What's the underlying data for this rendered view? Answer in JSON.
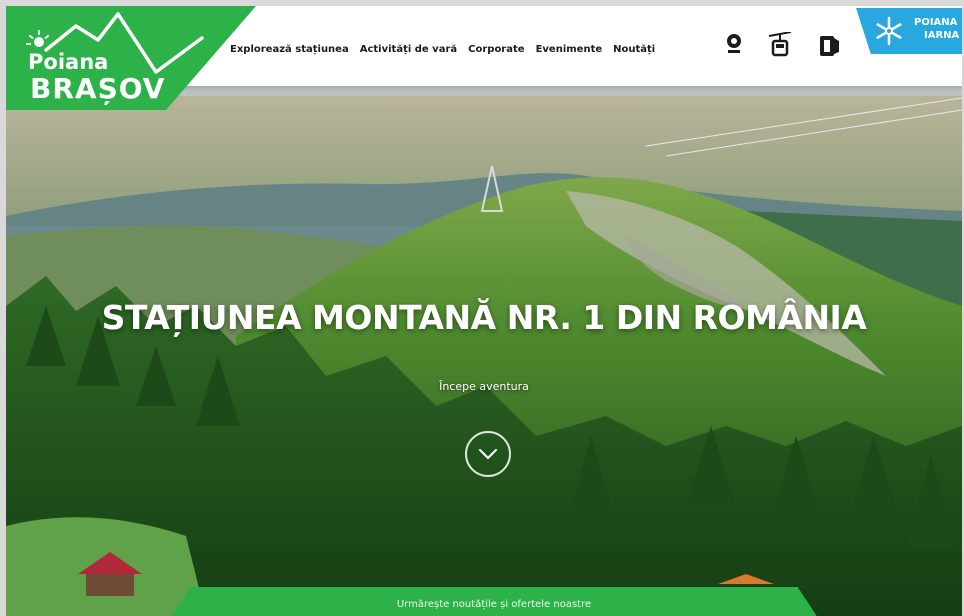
{
  "brand": {
    "logo_line_1": "Poiana",
    "logo_line_2": "BRAȘOV",
    "green": "#2db24a"
  },
  "nav": {
    "items": [
      {
        "label": "Explorează stațiunea"
      },
      {
        "label": "Activități de vară"
      },
      {
        "label": "Corporate"
      },
      {
        "label": "Evenimente"
      },
      {
        "label": "Noutăți"
      }
    ]
  },
  "utility_icons": [
    "webcam-icon",
    "cable-car-icon",
    "ski-pass-icon"
  ],
  "winter_tab": {
    "line_1": "POIANA",
    "line_2": "IARNA",
    "icon": "snowflake-icon",
    "color": "#29a8e0"
  },
  "hero": {
    "title": "STAȚIUNEA MONTANĂ NR. 1 DIN ROMÂNIA",
    "subtitle": "Începe aventura",
    "scroll_icon": "chevron-down-icon"
  },
  "footer_banner": {
    "text": "Urmărește noutățile și ofertele noastre"
  }
}
